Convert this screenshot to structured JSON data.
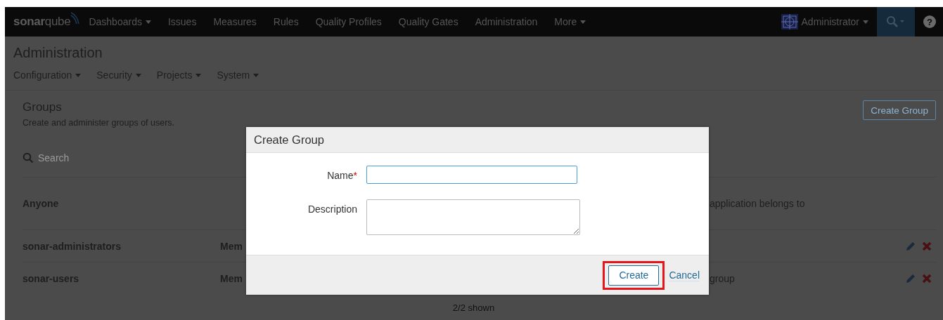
{
  "navbar": {
    "logo": {
      "bold": "sonar",
      "light": "qube"
    },
    "items": [
      {
        "label": "Dashboards",
        "dropdown": true
      },
      {
        "label": "Issues",
        "dropdown": false
      },
      {
        "label": "Measures",
        "dropdown": false
      },
      {
        "label": "Rules",
        "dropdown": false
      },
      {
        "label": "Quality Profiles",
        "dropdown": false
      },
      {
        "label": "Quality Gates",
        "dropdown": false
      },
      {
        "label": "Administration",
        "dropdown": false
      },
      {
        "label": "More",
        "dropdown": true
      }
    ],
    "user": {
      "name": "Administrator"
    },
    "help": "?"
  },
  "admin": {
    "title": "Administration",
    "menu": [
      {
        "label": "Configuration"
      },
      {
        "label": "Security"
      },
      {
        "label": "Projects"
      },
      {
        "label": "System"
      }
    ]
  },
  "groups": {
    "title": "Groups",
    "subtitle": "Create and administer groups of users.",
    "create_button": "Create Group",
    "search": {
      "placeholder": "Search"
    },
    "rows": [
      {
        "name": "Anyone",
        "members": "",
        "description": "application belongs to",
        "editable": false
      },
      {
        "name": "sonar-administrators",
        "members": "Mem",
        "description": "",
        "editable": true
      },
      {
        "name": "sonar-users",
        "members": "Mem",
        "description": "group",
        "editable": true
      }
    ],
    "shown": "2/2 shown"
  },
  "modal": {
    "title": "Create Group",
    "fields": [
      {
        "label": "Name",
        "required_mark": "*",
        "kind": "input",
        "focused": true
      },
      {
        "label": "Description",
        "kind": "textarea",
        "focused": false
      }
    ],
    "submit": {
      "label": "Create",
      "highlighted": true
    },
    "cancel": "Cancel"
  }
}
